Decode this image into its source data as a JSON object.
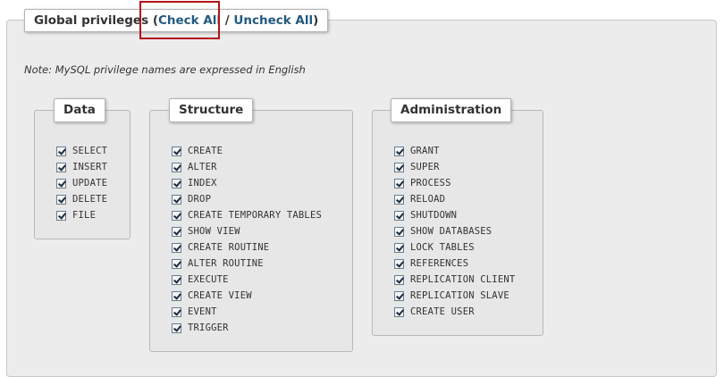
{
  "header": {
    "title": "Global privileges",
    "open_paren": "(",
    "check_all": "Check All",
    "separator": "/",
    "uncheck_all": "Uncheck All",
    "close_paren": ")"
  },
  "note": "Note: MySQL privilege names are expressed in English",
  "groups": {
    "data": {
      "title": "Data",
      "items": [
        "SELECT",
        "INSERT",
        "UPDATE",
        "DELETE",
        "FILE"
      ]
    },
    "structure": {
      "title": "Structure",
      "items": [
        "CREATE",
        "ALTER",
        "INDEX",
        "DROP",
        "CREATE TEMPORARY TABLES",
        "SHOW VIEW",
        "CREATE ROUTINE",
        "ALTER ROUTINE",
        "EXECUTE",
        "CREATE VIEW",
        "EVENT",
        "TRIGGER"
      ]
    },
    "administration": {
      "title": "Administration",
      "items": [
        "GRANT",
        "SUPER",
        "PROCESS",
        "RELOAD",
        "SHUTDOWN",
        "SHOW DATABASES",
        "LOCK TABLES",
        "REFERENCES",
        "REPLICATION CLIENT",
        "REPLICATION SLAVE",
        "CREATE USER"
      ]
    }
  },
  "colors": {
    "link": "#235a81",
    "highlight": "#b5121b",
    "panel_bg": "#ececec"
  }
}
